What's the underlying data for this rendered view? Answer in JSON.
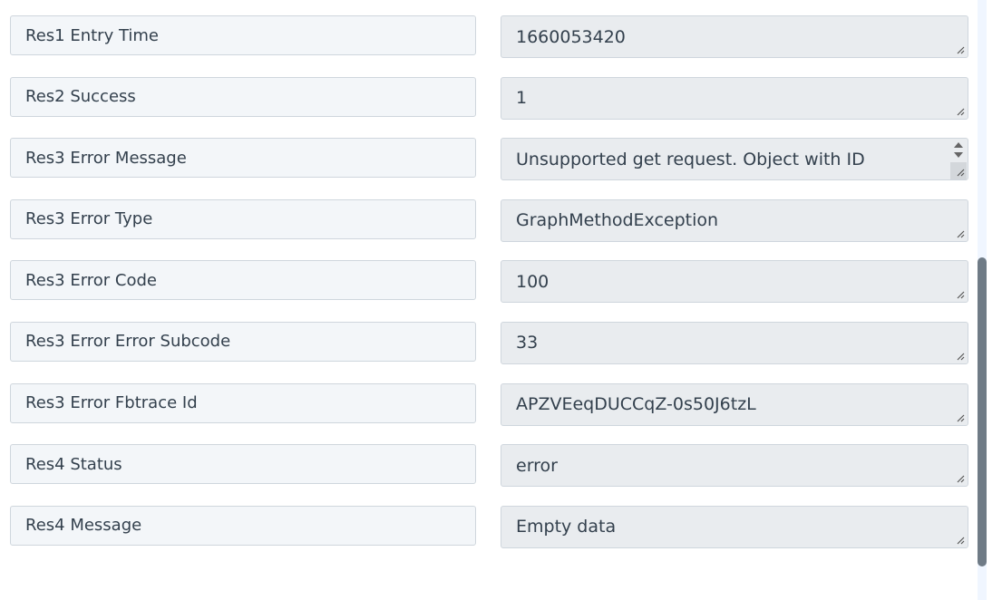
{
  "fields": [
    {
      "label": "Res1 Entry Time",
      "value": "1660053420"
    },
    {
      "label": "Res2 Success",
      "value": "1"
    },
    {
      "label": "Res3 Error Message",
      "value": "Unsupported get request. Object with ID"
    },
    {
      "label": "Res3 Error Type",
      "value": "GraphMethodException"
    },
    {
      "label": "Res3 Error Code",
      "value": "100"
    },
    {
      "label": "Res3 Error Error Subcode",
      "value": "33"
    },
    {
      "label": "Res3 Error Fbtrace Id",
      "value": "APZVEeqDUCCqZ-0s50J6tzL"
    },
    {
      "label": "Res4 Status",
      "value": "error"
    },
    {
      "label": "Res4 Message",
      "value": "Empty data"
    }
  ],
  "icons": {
    "resize": "resize-grip-icon",
    "spin_up": "spin-up-icon",
    "spin_down": "spin-down-icon"
  },
  "colors": {
    "label_bg": "#f3f6f9",
    "value_bg": "#e9ecef",
    "border": "#cfd6dd",
    "text": "#33404d",
    "scroll_thumb": "#6f7b86"
  }
}
